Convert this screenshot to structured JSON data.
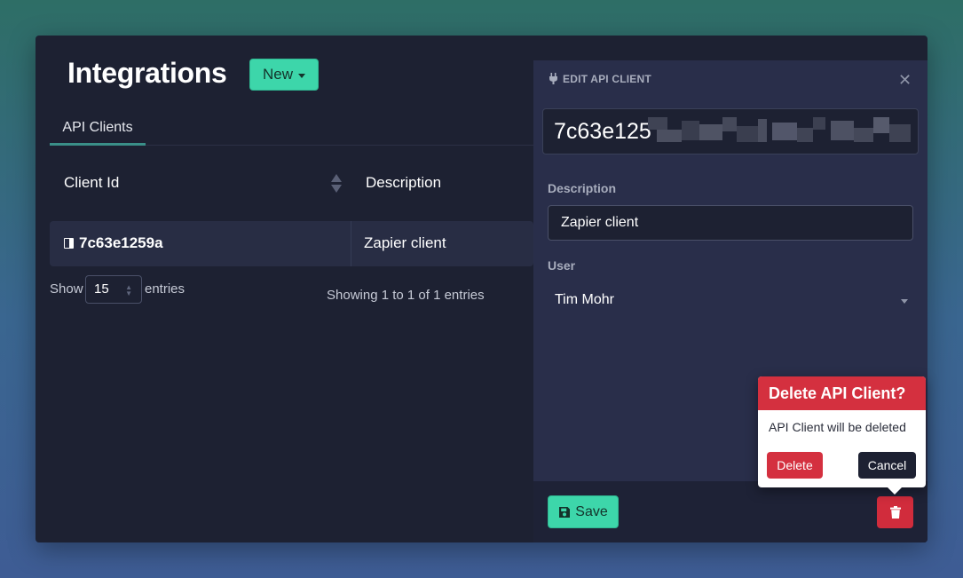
{
  "header": {
    "title": "Integrations",
    "new_label": "New"
  },
  "tabs": [
    {
      "label": "API Clients",
      "active": true
    }
  ],
  "table": {
    "columns": [
      "Client Id",
      "Description"
    ],
    "rows": [
      {
        "client_id": "7c63e1259a",
        "description": "Zapier client"
      }
    ]
  },
  "length_menu": {
    "show_label": "Show",
    "value": "15",
    "entries_label": "entries"
  },
  "table_info": "Showing 1 to 1 of 1 entries",
  "edit_panel": {
    "heading": "EDIT API CLIENT",
    "client_id_visible": "7c63e125",
    "description_label": "Description",
    "description_value": "Zapier client",
    "user_label": "User",
    "user_value": "Tim Mohr",
    "save_label": "Save"
  },
  "popover": {
    "title": "Delete API Client?",
    "body": "API Client will be deleted",
    "delete_label": "Delete",
    "cancel_label": "Cancel"
  },
  "colors": {
    "accent": "#3dd6aa",
    "danger": "#d4303f",
    "surface": "#1d2132",
    "panel": "#292e4a"
  },
  "icons": [
    "chevron-down-icon",
    "sort-icon",
    "panel-icon",
    "plug-icon",
    "close-icon",
    "save-icon",
    "trash-icon"
  ]
}
